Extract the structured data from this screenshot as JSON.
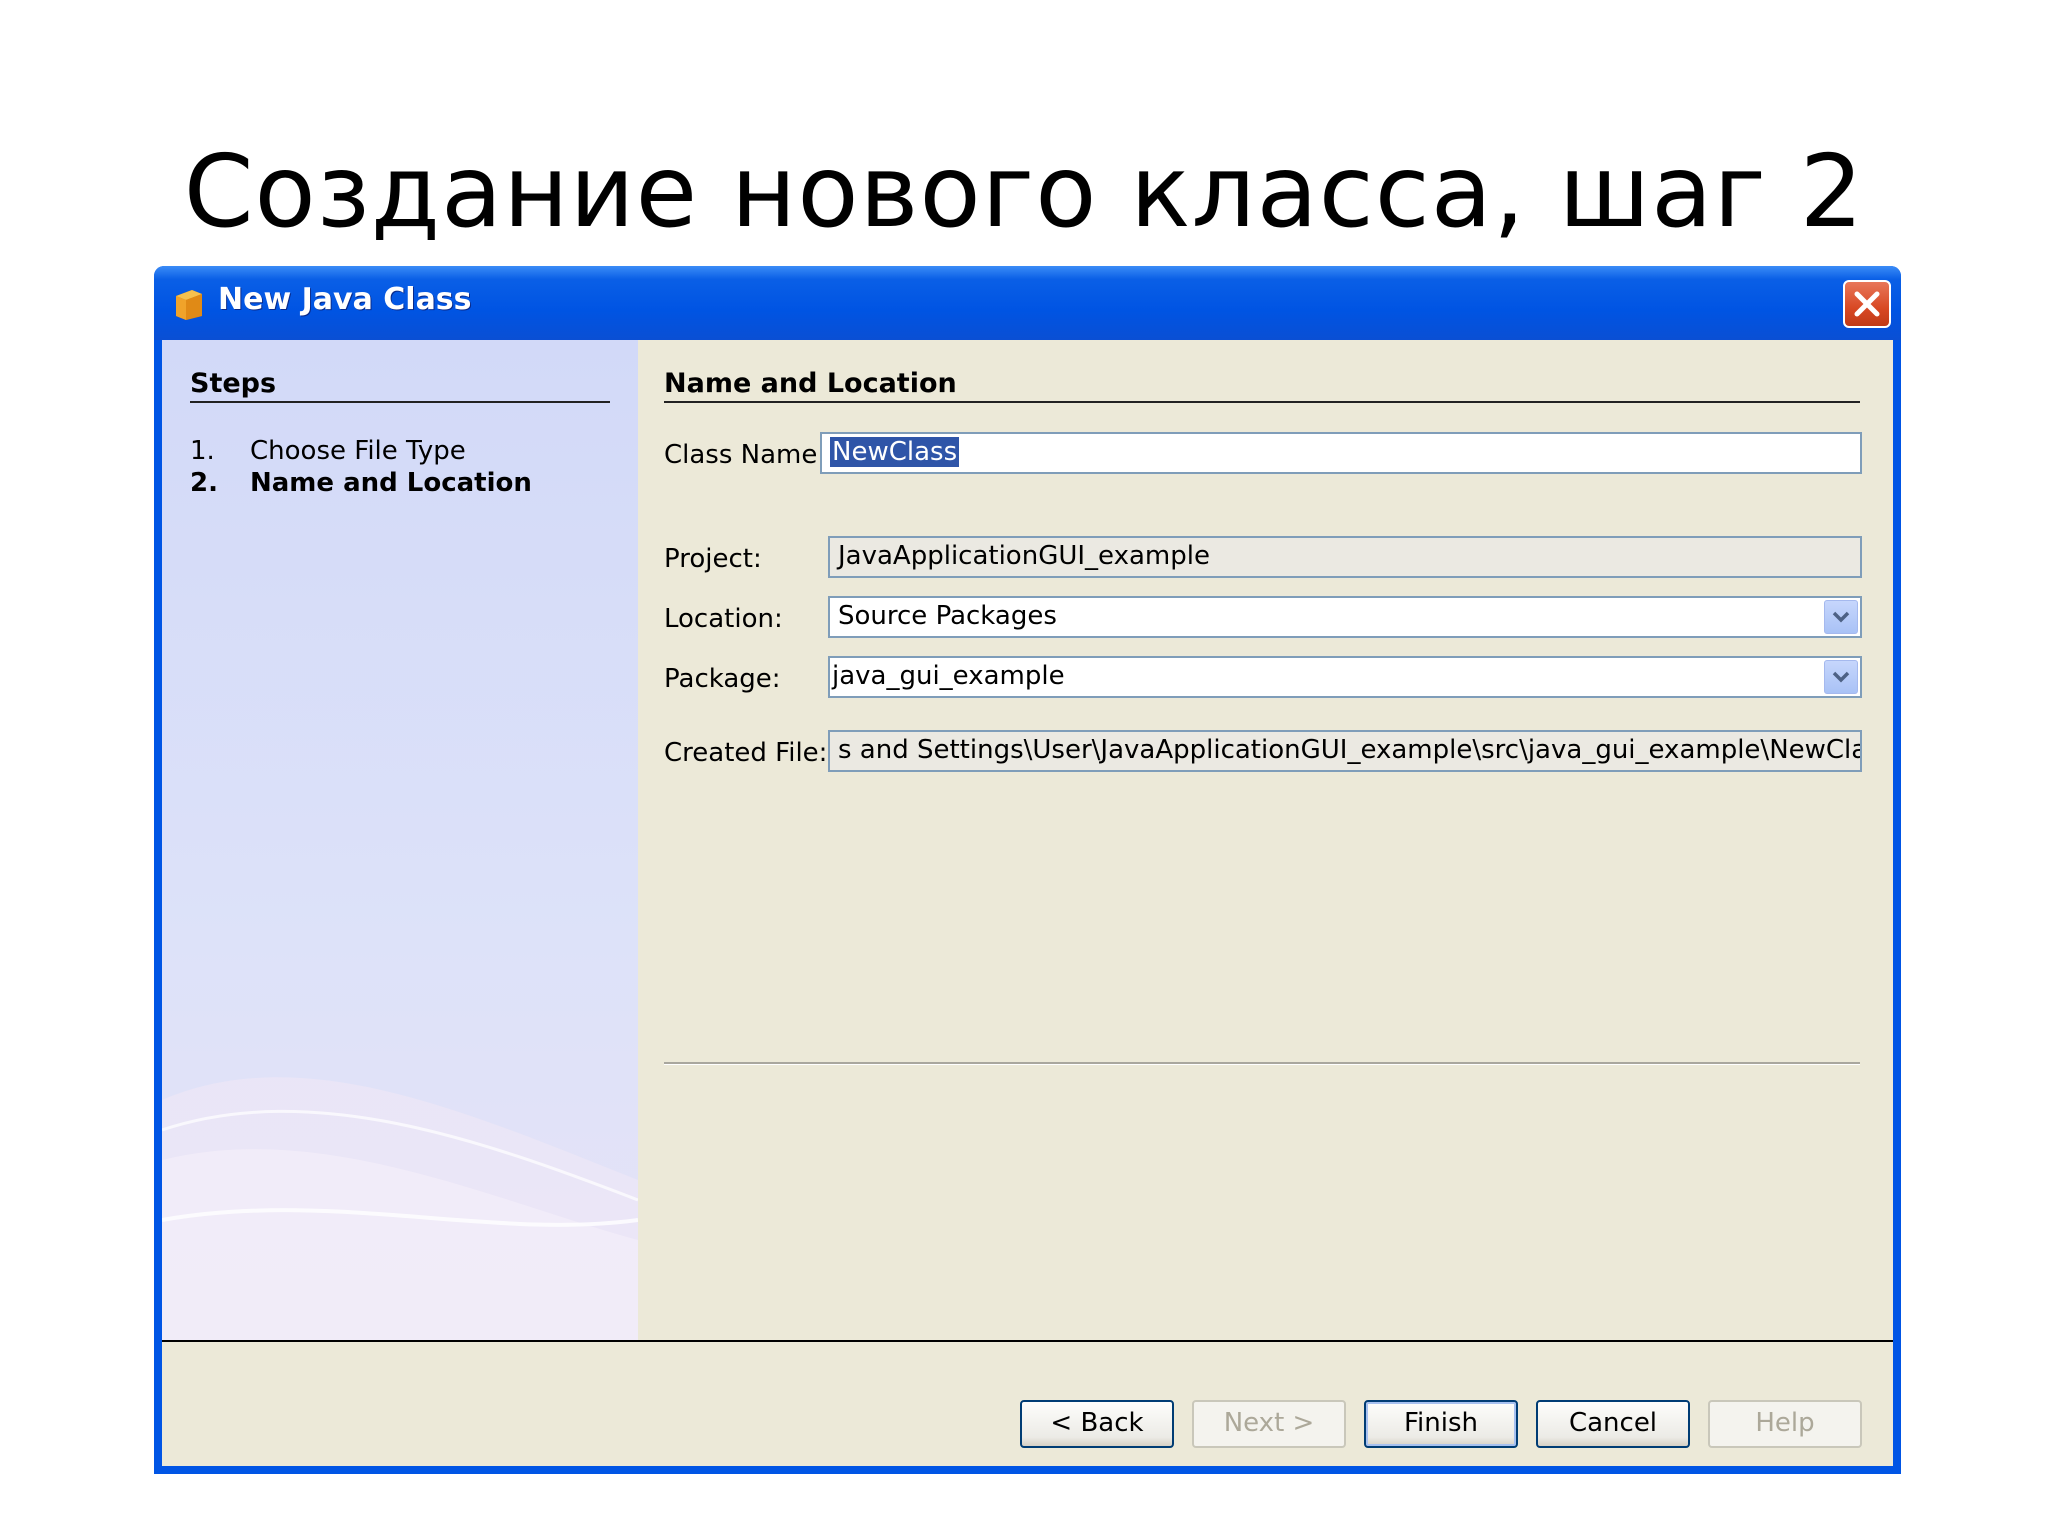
{
  "slide": {
    "title": "Создание нового класса, шаг 2"
  },
  "window": {
    "title": "New Java Class"
  },
  "steps": {
    "heading": "Steps",
    "items": [
      {
        "num": "1.",
        "label": "Choose File Type"
      },
      {
        "num": "2.",
        "label": "Name and Location"
      }
    ]
  },
  "content": {
    "heading": "Name and Location",
    "class_name_label": "Class Name:",
    "class_name_value": "NewClass",
    "project_label": "Project:",
    "project_value": "JavaApplicationGUI_example",
    "location_label": "Location:",
    "location_value": "Source Packages",
    "package_label": "Package:",
    "package_value": "java_gui_example",
    "created_file_label": "Created File:",
    "created_file_value": "s and Settings\\User\\JavaApplicationGUI_example\\src\\java_gui_example\\NewClass.java"
  },
  "buttons": {
    "back": "< Back",
    "next": "Next >",
    "finish": "Finish",
    "cancel": "Cancel",
    "help": "Help"
  }
}
